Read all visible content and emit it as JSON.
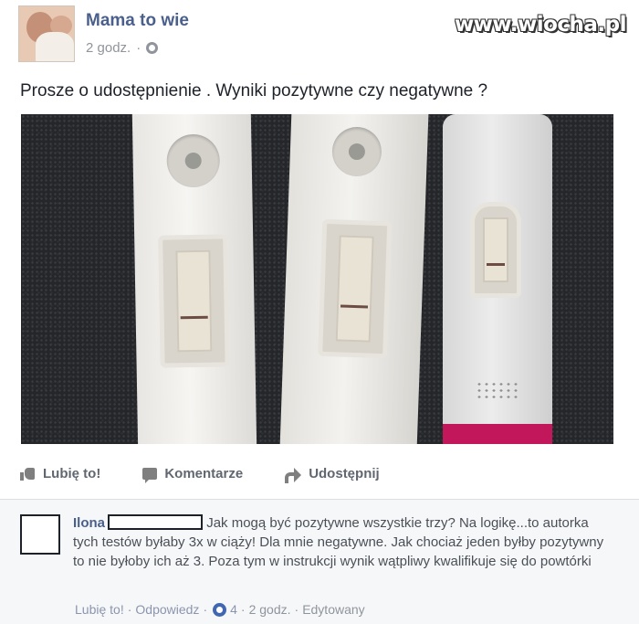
{
  "watermark": "www.wiocha.pl",
  "post": {
    "page_name": "Mama to wie",
    "time": "2 godz.",
    "separator": "·",
    "text": "Prosze o udostępnienie . Wyniki pozytywne czy negatywne ?"
  },
  "actions": {
    "like": "Lubię to!",
    "comment": "Komentarze",
    "share": "Udostępnij"
  },
  "comment": {
    "author": "Ilona",
    "text": "Jak mogą być pozytywne wszystkie trzy? Na logikę...to autorka tych testów byłaby 3x w ciąży! Dla mnie negatywne. Jak chociaż jeden byłby pozytywny to nie byłoby ich aż 3. Poza tym w instrukcji wynik wątpliwy kwalifikuje się do powtórki",
    "like_link": "Lubię to!",
    "reply_link": "Odpowiedz",
    "reaction_count": "4",
    "time": "2 godz.",
    "edited": "Edytowany",
    "separator": "·"
  },
  "colors": {
    "link_blue": "#4a5f8c",
    "meta_gray": "#90949c",
    "test_tip_pink": "#c2185b"
  }
}
